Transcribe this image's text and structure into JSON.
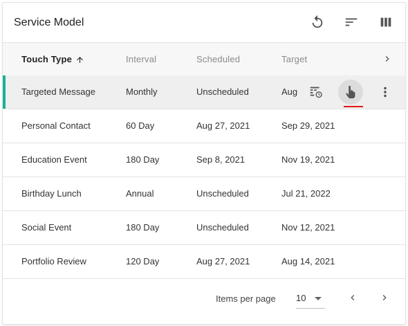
{
  "card": {
    "title": "Service Model",
    "toolbar": {
      "refresh_icon": "refresh-icon",
      "sort_icon": "sort-icon",
      "columns_icon": "columns-icon"
    }
  },
  "table": {
    "columns": [
      {
        "label": "Touch Type",
        "sorted": "ascending"
      },
      {
        "label": "Interval"
      },
      {
        "label": "Scheduled"
      },
      {
        "label": "Target"
      }
    ],
    "rows": [
      {
        "touch_type": "Targeted Message",
        "interval": "Monthly",
        "scheduled": "Unscheduled",
        "target": "Aug",
        "selected": true
      },
      {
        "touch_type": "Personal Contact",
        "interval": "60 Day",
        "scheduled": "Aug 27, 2021",
        "target": "Sep 29, 2021"
      },
      {
        "touch_type": "Education Event",
        "interval": "180 Day",
        "scheduled": "Sep 8, 2021",
        "target": "Nov 19, 2021"
      },
      {
        "touch_type": "Birthday Lunch",
        "interval": "Annual",
        "scheduled": "Unscheduled",
        "target": "Jul 21, 2022"
      },
      {
        "touch_type": "Social Event",
        "interval": "180 Day",
        "scheduled": "Unscheduled",
        "target": "Nov 12, 2021"
      },
      {
        "touch_type": "Portfolio Review",
        "interval": "120 Day",
        "scheduled": "Aug 27, 2021",
        "target": "Aug 14, 2021"
      }
    ],
    "row_actions": [
      "calendar-schedule-icon",
      "touch-hand-icon",
      "more-vert-icon"
    ]
  },
  "pagination": {
    "items_per_page_label": "Items per page",
    "items_per_page_value": "10"
  },
  "colors": {
    "accent": "#17b394",
    "selected_row_bg": "#efefef",
    "header_bg": "#f7f7f7",
    "underline": "#e01818"
  }
}
